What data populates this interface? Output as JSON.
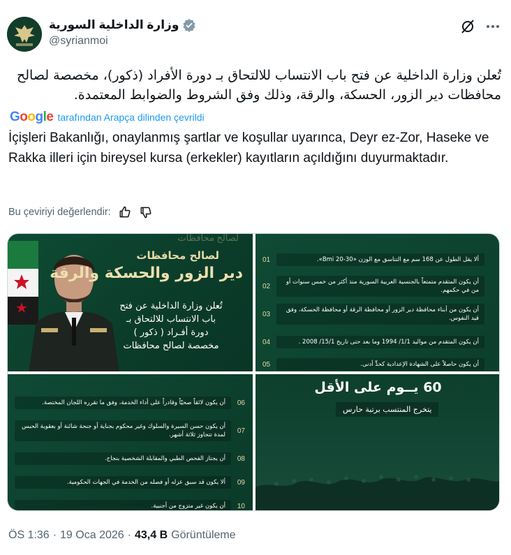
{
  "account": {
    "display_name": "وزارة الداخلية السورية",
    "handle": "@syrianmoi",
    "avatar_text": "وزارة الداخلية"
  },
  "tweet": {
    "arabic_text": "تُعلن وزارة الداخلية عن فتح باب الانتساب للالتحاق بـ دورة الأفراد (ذكور)، مخصصة لصالح محافظات دير الزور، الحسكة، والرقة، وذلك وفق الشروط والضوابط المعتمدة.",
    "translated_by": "tarafından Arapça dilinden çevrildi",
    "google_logo": "Google",
    "translation": "İçişleri Bakanlığı, onaylanmış şartlar ve koşullar uyarınca, Deyr ez-Zor, Haseke ve Rakka illeri için bireysel kursa (erkekler) kayıtların açıldığını duyurmaktadır.",
    "rate_label": "Bu çeviriyi değerlendir:"
  },
  "media": {
    "tile1": {
      "top": "لصالح محافظات",
      "gov": "لصالح محافظات",
      "cities": "دير الزور والحسكة والرقة",
      "body": "تُعلن وزارة الداخلية عن فتح باب الانتساب للالتحاق بـ دورة أفـراد ( ذكور ) مخصصة لصالح محافظات"
    },
    "requirements_top": [
      {
        "num": "01",
        "text": "ألا يقل الطول عن 168 سم مع التناسق مع الوزن «Bmi 20-30»."
      },
      {
        "num": "02",
        "text": "أن يكون المتقدم متمتعاً بالجنسية العربية السورية منذ أكثر من خمس سنوات أو من في حكمهم."
      },
      {
        "num": "03",
        "text": "أن يكون من أبناء محافظة دير الزور أو محافظة الرقة أو محافظة الحسكة، وفق قيد النفوس."
      },
      {
        "num": "04",
        "text": "أن يكون المتقدم من مواليد 1/1/ 1994 وما بعد حتى تاريخ 15/1/ 2008 ."
      },
      {
        "num": "05",
        "text": "أن يكون حاصلاً على الشهادة الإعدادية كحدٍّ أدنى."
      }
    ],
    "requirements_bottom": [
      {
        "num": "06",
        "text": "أن يكون لائقاً صحيّاً وقادراً على أداء الخدمة، وفق ما تقرره اللجان المختصة."
      },
      {
        "num": "07",
        "text": "أن يكون حسن السيرة والسلوك وغير محكوم بجناية أو جنحة شائنة أو بعقوبة الحبس لمدة تتجاوز ثلاثة أشهر."
      },
      {
        "num": "08",
        "text": "أن يجتاز الفحص الطبي والمقابلة الشخصية بنجاح."
      },
      {
        "num": "09",
        "text": "ألا يكون قد سبق عزله أو فصله من الخدمة في الجهات الحكومية."
      },
      {
        "num": "10",
        "text": "أن يكون غير متزوج من أجنبية."
      }
    ],
    "tile4": {
      "days": "60 يــوم على الأقل",
      "graduate": "يتخرج المنتسب برتبة حارس"
    }
  },
  "footer": {
    "time": "ÖS 1:36",
    "sep1": "·",
    "date": "19 Oca 2026",
    "sep2": "·",
    "views_count": "43,4 B",
    "views_label": "Görüntüleme"
  },
  "colors": {
    "accent": "#1d9bf0",
    "secondary_text": "#536471",
    "media_green": "#0e4b34",
    "gold_text": "#e7d9a6"
  }
}
